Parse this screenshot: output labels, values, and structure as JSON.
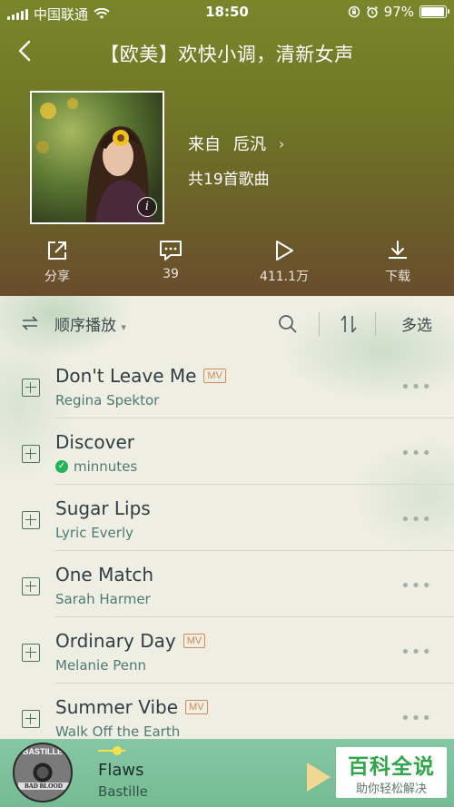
{
  "status_bar": {
    "carrier": "中国联通",
    "time": "18:50",
    "battery": "97%",
    "battery_level": 0.97
  },
  "header": {
    "title": "【欧美】欢快小调，清新女声",
    "from_label": "来自",
    "creator": "卮汎",
    "song_count": "共19首歌曲"
  },
  "actions": [
    {
      "label": "分享",
      "icon": "share-icon"
    },
    {
      "label": "39",
      "icon": "comment-icon"
    },
    {
      "label": "411.1万",
      "icon": "play-icon"
    },
    {
      "label": "下载",
      "icon": "download-icon"
    }
  ],
  "toolbar": {
    "play_mode": "顺序播放",
    "multi_select": "多选"
  },
  "songs": [
    {
      "title": "Don't Leave Me",
      "artist": "Regina Spektor",
      "mv": "MV"
    },
    {
      "title": "Discover",
      "artist": "minnutes"
    },
    {
      "title": "Sugar Lips",
      "artist": "Lyric Everly"
    },
    {
      "title": "One Match",
      "artist": "Sarah Harmer"
    },
    {
      "title": "Ordinary Day",
      "artist": "Melanie Penn",
      "mv": "MV"
    },
    {
      "title": "Summer Vibe",
      "artist": "Walk Off the Earth",
      "mv": "MV"
    }
  ],
  "player": {
    "title": "Flaws",
    "artist": "Bastille",
    "cover_band": "BASTILLE",
    "cover_album": "BAD BLOOD"
  },
  "watermark": {
    "main": "百科全说",
    "sub": "助你轻松解决"
  }
}
